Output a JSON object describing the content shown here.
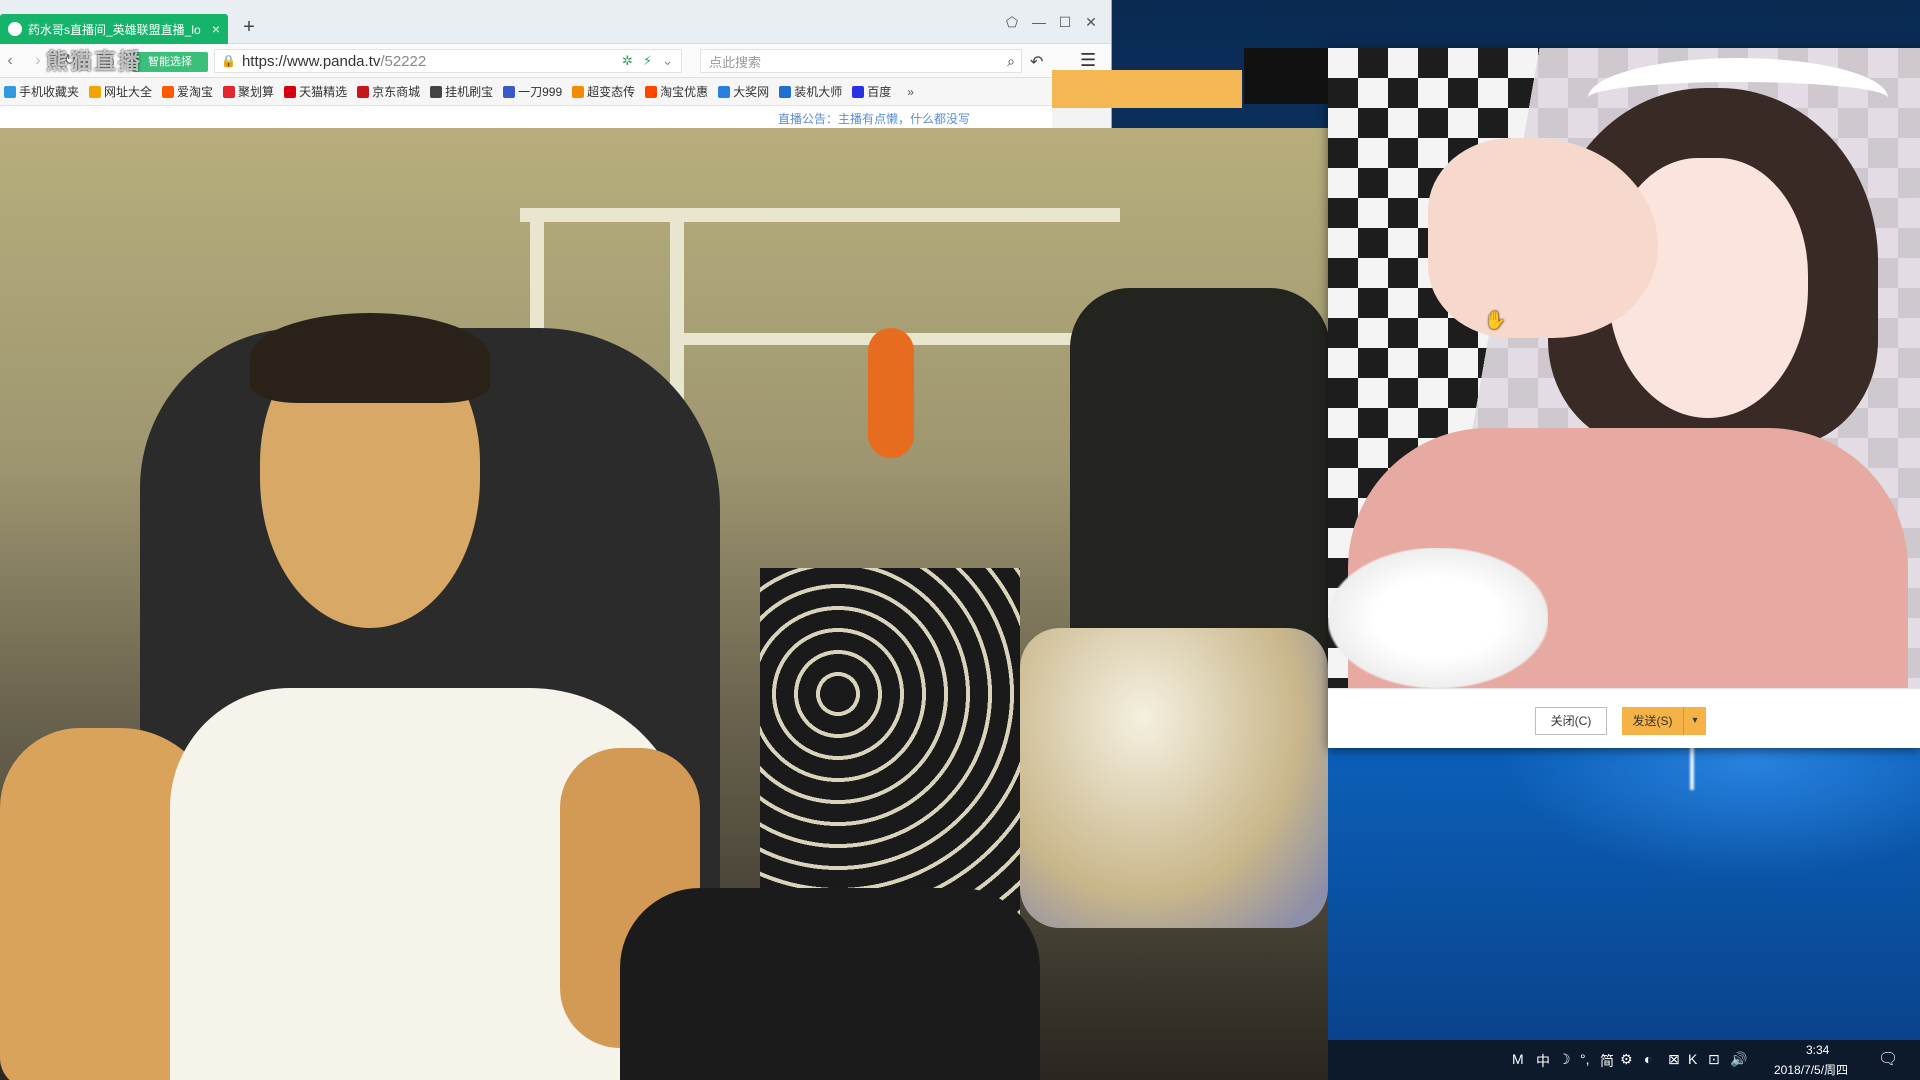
{
  "browser": {
    "tab_title": "药水哥s直播间_英雄联盟直播_lo",
    "tab_close": "×",
    "new_tab": "+",
    "window_controls": {
      "skin": "⬠",
      "minimize": "—",
      "maximize": "☐",
      "close": "✕"
    },
    "nav": {
      "back": "‹",
      "forward": "›",
      "refresh": "↻",
      "home": "⌂"
    },
    "url_badge": "智能选择",
    "url_host": "https://www.panda.tv",
    "url_path": "/52222",
    "search_placeholder": "点此搜索",
    "bookmarks": [
      {
        "label": "手机收藏夹",
        "color": "#2f9ae0"
      },
      {
        "label": "网址大全",
        "color": "#f0a500"
      },
      {
        "label": "爱淘宝",
        "color": "#ff5a00"
      },
      {
        "label": "聚划算",
        "color": "#e3262e"
      },
      {
        "label": "天猫精选",
        "color": "#d6000f"
      },
      {
        "label": "京东商城",
        "color": "#c8161d"
      },
      {
        "label": "挂机刷宝",
        "color": "#444444"
      },
      {
        "label": "一刀999",
        "color": "#3a59c8"
      },
      {
        "label": "超变态传",
        "color": "#f18b00"
      },
      {
        "label": "淘宝优惠",
        "color": "#ff4400"
      },
      {
        "label": "大奖网",
        "color": "#2a7de1"
      },
      {
        "label": "装机大师",
        "color": "#1f6fd0"
      },
      {
        "label": "百度",
        "color": "#2932e1"
      }
    ],
    "bookmarks_more": "»",
    "page_notice": "直播公告：主播有点懒，什么都没写"
  },
  "video": {
    "watermark": "熊猫直播"
  },
  "dialog": {
    "close_label": "关闭(C)",
    "send_label": "发送(S)",
    "send_arrow": "▾"
  },
  "taskbar": {
    "tray_icons": [
      "M",
      "中",
      "☽",
      "°,",
      "简",
      "⚙",
      "◐",
      "⊠",
      "K",
      "⊡",
      "🔊"
    ],
    "time": "3:34",
    "date": "2018/7/5/周四",
    "notification_icon": "🗨"
  }
}
